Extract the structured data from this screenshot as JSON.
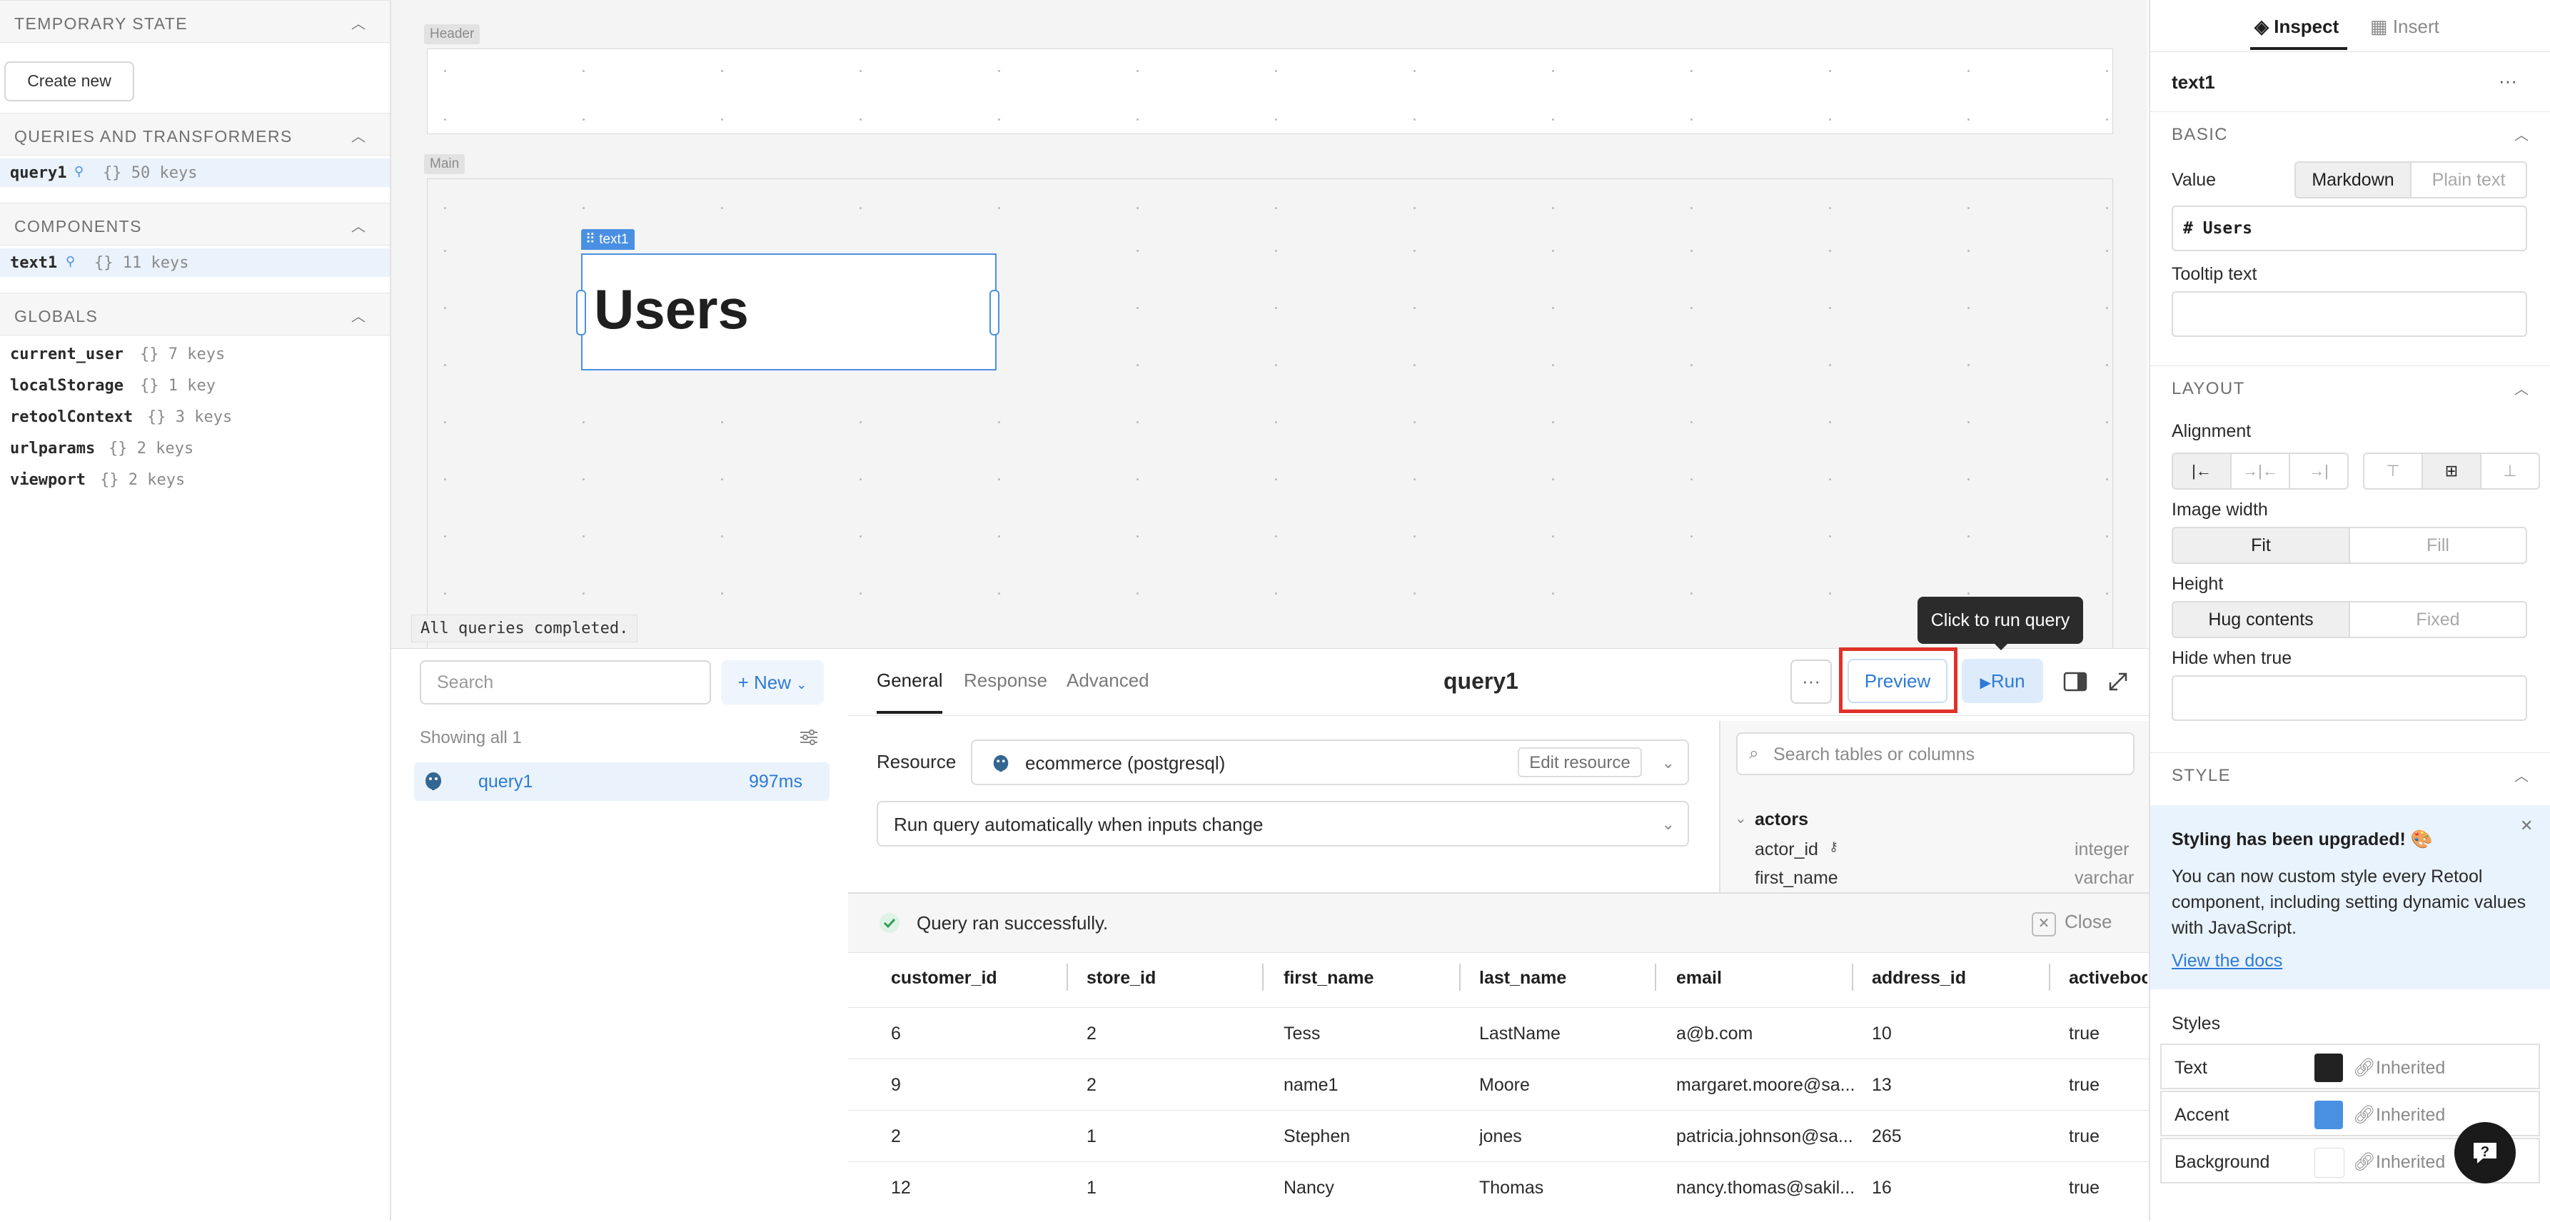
{
  "left_panel": {
    "temporary_state": {
      "title": "TEMPORARY STATE",
      "create_button": "Create new"
    },
    "queries": {
      "title": "QUERIES AND TRANSFORMERS",
      "items": [
        {
          "name": "query1",
          "meta": "{}  50 keys"
        }
      ]
    },
    "components": {
      "title": "COMPONENTS",
      "items": [
        {
          "name": "text1",
          "meta": "{}  11 keys"
        }
      ]
    },
    "globals": {
      "title": "GLOBALS",
      "items": [
        {
          "name": "current_user",
          "meta": "{}  7 keys"
        },
        {
          "name": "localStorage",
          "meta": "{}  1 key"
        },
        {
          "name": "retoolContext",
          "meta": "{}  3 keys"
        },
        {
          "name": "urlparams",
          "meta": "{}  2 keys"
        },
        {
          "name": "viewport",
          "meta": "{}  2 keys"
        }
      ]
    }
  },
  "canvas": {
    "header_label": "Header",
    "main_label": "Main",
    "component_tag": "text1",
    "heading_text": "Users",
    "status_message": "All queries completed."
  },
  "query_list": {
    "search_placeholder": "Search",
    "new_button": "+ New",
    "showing": "Showing all 1",
    "items": [
      {
        "name": "query1",
        "duration": "997ms"
      }
    ]
  },
  "editor": {
    "tabs": [
      "General",
      "Response",
      "Advanced"
    ],
    "active_tab": "General",
    "title": "query1",
    "more_label": "···",
    "preview_label": "Preview",
    "run_label": "Run",
    "tooltip": "Click to run query",
    "resource_label": "Resource",
    "resource_value": "ecommerce (postgresql)",
    "edit_resource": "Edit resource",
    "run_mode": "Run query automatically when inputs change",
    "schema": {
      "search_placeholder": "Search tables or columns",
      "table": "actors",
      "columns": [
        {
          "name": "actor_id",
          "type": "integer"
        },
        {
          "name": "first_name",
          "type": "varchar"
        }
      ]
    }
  },
  "results": {
    "success": "Query ran successfully.",
    "close": "Close",
    "columns": [
      "customer_id",
      "store_id",
      "first_name",
      "last_name",
      "email",
      "address_id",
      "activeboo"
    ],
    "rows": [
      [
        "6",
        "2",
        "Tess",
        "LastName",
        "a@b.com",
        "10",
        "true"
      ],
      [
        "9",
        "2",
        "name1",
        "Moore",
        "margaret.moore@sa...",
        "13",
        "true"
      ],
      [
        "2",
        "1",
        "Stephen",
        "jones",
        "patricia.johnson@sa...",
        "265",
        "true"
      ],
      [
        "12",
        "1",
        "Nancy",
        "Thomas",
        "nancy.thomas@sakil...",
        "16",
        "true"
      ]
    ]
  },
  "inspector": {
    "tabs": [
      "Inspect",
      "Insert"
    ],
    "component_name": "text1",
    "more_label": "···",
    "basic": {
      "title": "BASIC",
      "value_label": "Value",
      "mode_options": [
        "Markdown",
        "Plain text"
      ],
      "value": "# Users",
      "tooltip_label": "Tooltip text"
    },
    "layout": {
      "title": "LAYOUT",
      "alignment_label": "Alignment",
      "image_width_label": "Image width",
      "image_width_options": [
        "Fit",
        "Fill"
      ],
      "height_label": "Height",
      "height_options": [
        "Hug contents",
        "Fixed"
      ],
      "hide_label": "Hide when true"
    },
    "style": {
      "title": "STYLE",
      "notice_title": "Styling has been upgraded! 🎨",
      "notice_body": "You can now custom style every Retool component, including setting dynamic values with JavaScript.",
      "notice_link": "View the docs",
      "styles_label": "Styles",
      "rows": [
        {
          "name": "Text",
          "color": "#222222",
          "value": "Inherited"
        },
        {
          "name": "Accent",
          "color": "#4a90e2",
          "value": "Inherited"
        },
        {
          "name": "Background",
          "color": "#ffffff",
          "value": "Inherited"
        }
      ]
    }
  },
  "colors": {
    "accent": "#4a90e2",
    "link": "#2d7ad6",
    "highlight": "#e0322a",
    "success": "#2e9c57"
  }
}
